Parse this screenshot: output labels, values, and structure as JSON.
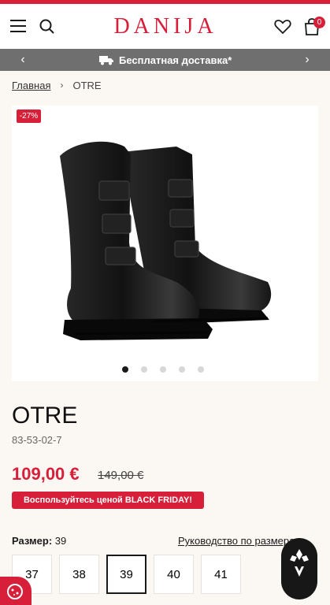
{
  "header": {
    "logo": "DANIJA",
    "cart_count": "0",
    "icons": [
      "menu-icon",
      "search-icon",
      "heart-icon",
      "cart-icon"
    ]
  },
  "promo_bar": {
    "text": "Бесплатная доставка*",
    "icon": "truck-icon"
  },
  "breadcrumb": {
    "home": "Главная",
    "current": "OTRE"
  },
  "gallery": {
    "discount": "-27%",
    "slide_count": 5,
    "active_slide": 1
  },
  "product": {
    "title": "OTRE",
    "sku": "83-53-02-7",
    "price": "109,00 €",
    "old_price": "149,00 €",
    "promo_label": "Воспользуйтесь ценой BLACK FRIDAY!"
  },
  "size_selector": {
    "label": "Размер:",
    "selected": "39",
    "guide": "Руководство по размерам",
    "sizes": [
      "37",
      "38",
      "39",
      "40",
      "41"
    ]
  },
  "colors": {
    "accent": "#d71f3a",
    "promo_bar": "#6f6f6f",
    "background": "#fbf8f4"
  }
}
